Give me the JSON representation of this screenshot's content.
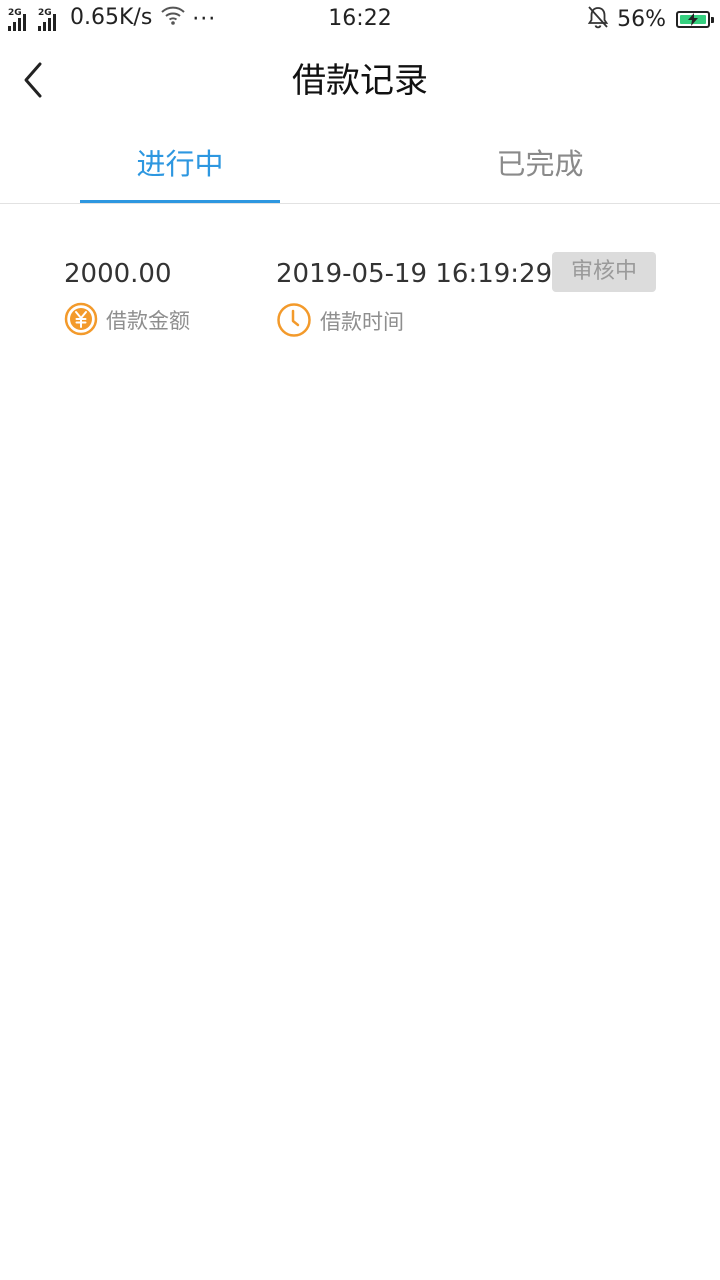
{
  "status_bar": {
    "signal1_label": "2G",
    "signal2_label": "2G",
    "network_speed": "0.65K/s",
    "more": "···",
    "time": "16:22",
    "battery_percent": "56%",
    "battery_level": 0.56
  },
  "header": {
    "title": "借款记录",
    "back_icon": "chevron-left-icon"
  },
  "tabs": [
    {
      "label": "进行中",
      "active": true
    },
    {
      "label": "已完成",
      "active": false
    }
  ],
  "colors": {
    "accent": "#2d97e0",
    "icon_orange": "#f39a2b",
    "badge_bg": "#dcdcdc"
  },
  "records": [
    {
      "amount": "2000.00",
      "amount_label": "借款金额",
      "amount_icon": "yuan-coin-icon",
      "time": "2019-05-19 16:19:29",
      "time_label": "借款时间",
      "time_icon": "clock-icon",
      "status": "审核中"
    }
  ]
}
